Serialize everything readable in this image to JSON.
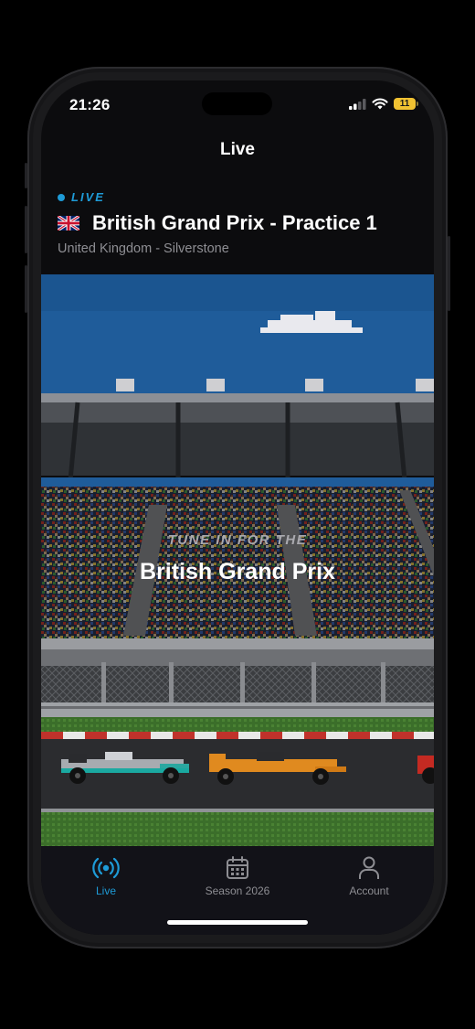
{
  "status_bar": {
    "time": "21:26",
    "battery": "11"
  },
  "nav": {
    "title": "Live"
  },
  "event": {
    "status": "LIVE",
    "title": "British Grand Prix - Practice 1",
    "location": "United Kingdom - Silverstone"
  },
  "hero": {
    "kicker": "TUNE IN FOR THE",
    "title": "British Grand Prix"
  },
  "tabs": [
    {
      "label": "Live",
      "icon": "broadcast-icon",
      "active": true
    },
    {
      "label": "Season 2026",
      "icon": "calendar-icon",
      "active": false
    },
    {
      "label": "Account",
      "icon": "person-icon",
      "active": false
    }
  ],
  "colors": {
    "accent": "#1e9bd7",
    "inactive": "#8e8e93",
    "background": "#0c0c0e",
    "tabbar": "#121218"
  }
}
